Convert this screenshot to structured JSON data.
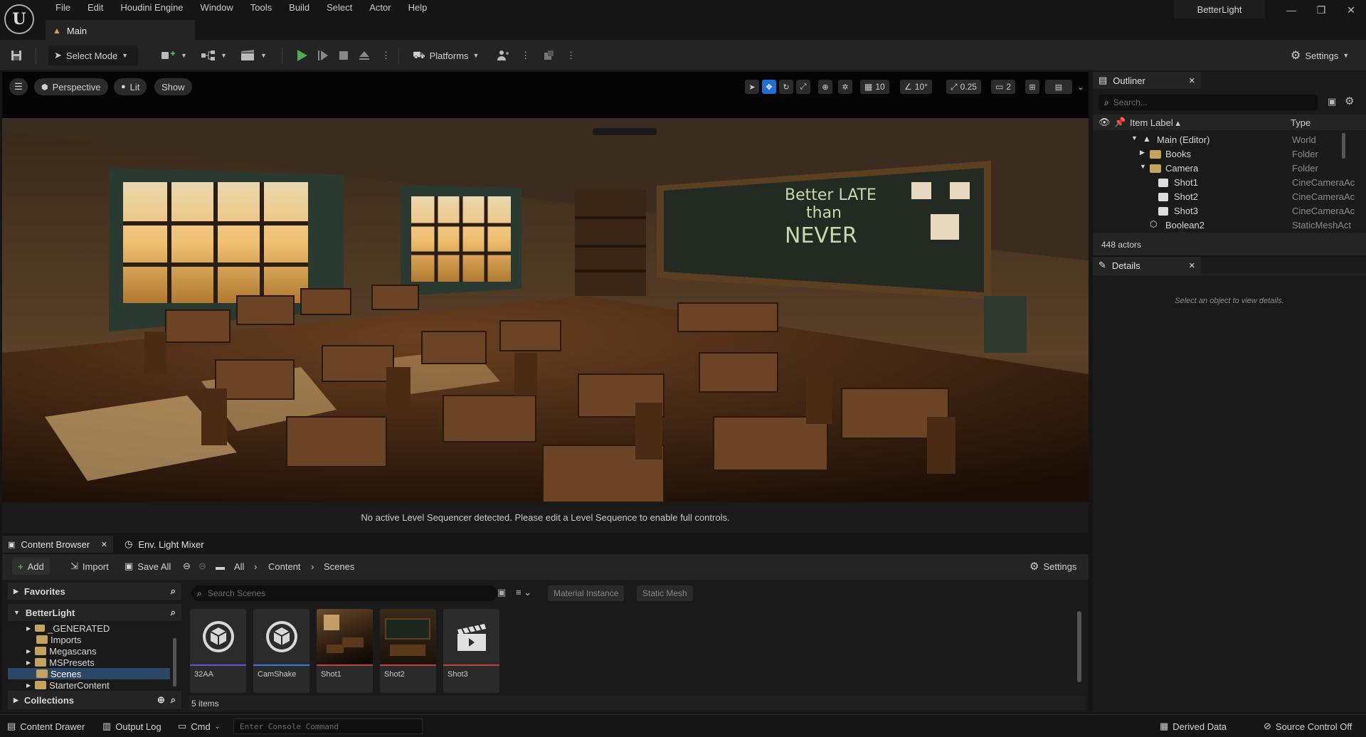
{
  "menu": [
    "File",
    "Edit",
    "Houdini Engine",
    "Window",
    "Tools",
    "Build",
    "Select",
    "Actor",
    "Help"
  ],
  "tab": {
    "label": "Main"
  },
  "project_name": "BetterLight",
  "toolbar": {
    "select_mode": "Select Mode",
    "platforms": "Platforms",
    "settings": "Settings"
  },
  "viewport": {
    "perspective": "Perspective",
    "lit": "Lit",
    "show": "Show",
    "grid_snap": "10",
    "rotation_snap": "10°",
    "scale_snap": "0.25",
    "camera_speed": "2",
    "message": "No active Level Sequencer detected. Please edit a Level Sequence to enable full controls."
  },
  "outliner": {
    "title": "Outliner",
    "search_placeholder": "Search...",
    "col_label": "Item Label ▴",
    "col_type": "Type",
    "rows": [
      {
        "label": "Main (Editor)",
        "type": "World"
      },
      {
        "label": "Books",
        "type": "Folder"
      },
      {
        "label": "Camera",
        "type": "Folder"
      },
      {
        "label": "Shot1",
        "type": "CineCameraAc"
      },
      {
        "label": "Shot2",
        "type": "CineCameraAc"
      },
      {
        "label": "Shot3",
        "type": "CineCameraAc"
      },
      {
        "label": "Boolean2",
        "type": "StaticMeshAct"
      }
    ],
    "count": "448 actors"
  },
  "details": {
    "title": "Details",
    "empty": "Select an object to view details."
  },
  "content_browser": {
    "tab1": "Content Browser",
    "tab2": "Env. Light Mixer",
    "add": "Add",
    "import": "Import",
    "save_all": "Save All",
    "path": [
      "All",
      "Content",
      "Scenes"
    ],
    "settings": "Settings",
    "favorites": "Favorites",
    "project": "BetterLight",
    "tree": [
      "_GENERATED",
      "Imports",
      "Megascans",
      "MSPresets",
      "Scenes",
      "StarterContent"
    ],
    "collections": "Collections",
    "search_placeholder": "Search Scenes",
    "filters": [
      "Material Instance",
      "Static Mesh"
    ],
    "assets": [
      {
        "name": "32AA",
        "stripe": "#6a4fd8"
      },
      {
        "name": "CamShake",
        "stripe": "#3f78d8"
      },
      {
        "name": "Shot1",
        "stripe": "#c2403d"
      },
      {
        "name": "Shot2",
        "stripe": "#c2403d"
      },
      {
        "name": "Shot3",
        "stripe": "#c2403d"
      }
    ],
    "item_count": "5 items"
  },
  "statusbar": {
    "content_drawer": "Content Drawer",
    "output_log": "Output Log",
    "cmd": "Cmd",
    "console_placeholder": "Enter Console Command",
    "derived_data": "Derived Data",
    "source_control": "Source Control Off"
  }
}
